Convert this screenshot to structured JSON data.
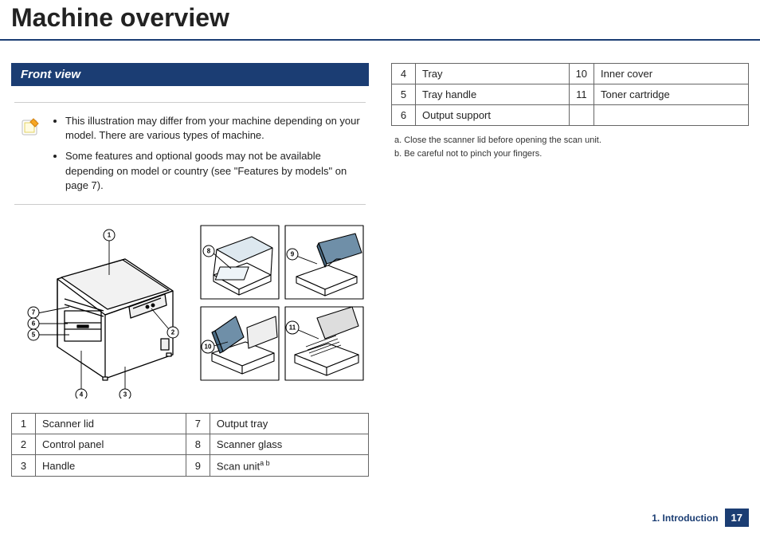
{
  "title": "Machine overview",
  "section": "Front view",
  "notes": [
    "This illustration may differ from your machine depending on your model. There are various types of machine.",
    "Some features and optional goods may not be available depending on model or country (see \"Features by models\" on page 7)."
  ],
  "parts_left": [
    {
      "n": "1",
      "name": "Scanner lid"
    },
    {
      "n": "2",
      "name": "Control panel"
    },
    {
      "n": "3",
      "name": "Handle"
    }
  ],
  "parts_mid": [
    {
      "n": "7",
      "name": "Output tray"
    },
    {
      "n": "8",
      "name": "Scanner glass"
    },
    {
      "n": "9",
      "name": "Scan unit",
      "sup": "a b"
    }
  ],
  "parts_right_a": [
    {
      "n": "4",
      "name": "Tray"
    },
    {
      "n": "5",
      "name": "Tray handle"
    },
    {
      "n": "6",
      "name": "Output support"
    }
  ],
  "parts_right_b": [
    {
      "n": "10",
      "name": "Inner cover"
    },
    {
      "n": "11",
      "name": "Toner cartridge"
    }
  ],
  "footnotes": {
    "a": "a.  Close the scanner lid before opening the scan unit.",
    "b": "b.  Be careful not to pinch your fingers."
  },
  "footer": {
    "chapter": "1. Introduction",
    "page": "17"
  },
  "callouts": {
    "c1": "1",
    "c2": "2",
    "c3": "3",
    "c4": "4",
    "c5": "5",
    "c6": "6",
    "c7": "7",
    "c8": "8",
    "c9": "9",
    "c10": "10",
    "c11": "11"
  }
}
